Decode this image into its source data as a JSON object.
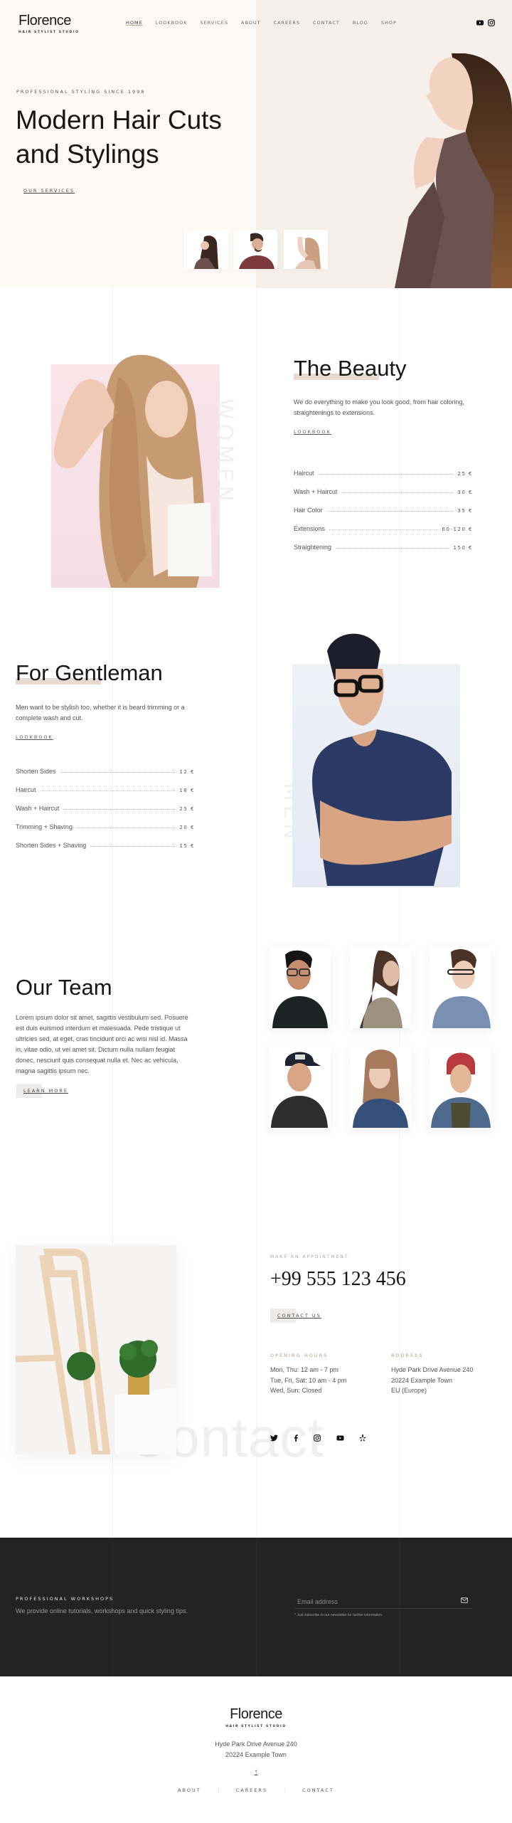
{
  "brand": {
    "name": "Florence",
    "tagline": "HAIR STYLIST STUDIO"
  },
  "nav": {
    "items": [
      {
        "label": "HOME",
        "active": true
      },
      {
        "label": "LOOKBOOK",
        "active": false
      },
      {
        "label": "SERVICES",
        "active": false
      },
      {
        "label": "ABOUT",
        "active": false
      },
      {
        "label": "CAREERS",
        "active": false
      },
      {
        "label": "CONTACT",
        "active": false
      },
      {
        "label": "BLOG",
        "active": false
      },
      {
        "label": "SHOP",
        "active": false
      }
    ],
    "social": [
      "youtube-icon",
      "instagram-icon"
    ]
  },
  "hero": {
    "kicker": "PROFESSIONAL STYLING SINCE 1998",
    "title_line1": "Modern Hair Cuts",
    "title_line2": "and Stylings",
    "button": "OUR SERVICES",
    "thumbnails": [
      "woman-profile",
      "man-beard",
      "woman-arm-raised"
    ]
  },
  "beauty": {
    "title": "The Beauty",
    "text": "We do everything to make you look good, from hair coloring, straightenings to extensions.",
    "link": "LOOKBOOK",
    "ghost_label": "WOMEN",
    "prices": [
      {
        "name": "Haircut",
        "price": "25 €"
      },
      {
        "name": "Wash + Haircut",
        "price": "30 €"
      },
      {
        "name": "Hair Color",
        "price": "35 €"
      },
      {
        "name": "Extensions",
        "price": "60-120 €"
      },
      {
        "name": "Straightening",
        "price": "150 €"
      }
    ]
  },
  "gentleman": {
    "title": "For Gentleman",
    "text": "Men want to be stylish too, whether it is beard trimming or a complete wash and cut.",
    "link": "LOOKBOOK",
    "ghost_label": "MEN",
    "prices": [
      {
        "name": "Shorten Sides",
        "price": "12 €"
      },
      {
        "name": "Haircut",
        "price": "18 €"
      },
      {
        "name": "Wash + Haircut",
        "price": "25 €"
      },
      {
        "name": "Trimming + Shaving",
        "price": "20 €"
      },
      {
        "name": "Shorten Sides + Shaving",
        "price": "15 €"
      }
    ]
  },
  "team": {
    "title": "Our Team",
    "text": "Lorem ipsum dolor sit amet, sagittis vestibulum sed. Posuere est duis euismod interdum et malesuada. Pede tristique ut ultricies sed, at eget, cras tincidunt orci ac wisi nisl id. Massa in, vitae odio, ut vel amet sit. Dictum nulla nullam feugiat donec, nesciunt quis consequat nulla et. Nec ac vehicula, magna sagittis ipsum nec.",
    "button": "LEARN MORE",
    "members": [
      {
        "photo": "man-glasses-black-tee"
      },
      {
        "photo": "woman-long-hair-looking-down"
      },
      {
        "photo": "man-glasses-denim-shirt"
      },
      {
        "photo": "man-cap-smiling"
      },
      {
        "photo": "woman-bangs-denim-jacket"
      },
      {
        "photo": "man-red-cap"
      }
    ]
  },
  "contact": {
    "kicker": "MAKE AN APPOINTMENT",
    "phone": "+99 555 123 456",
    "button": "CONTACT US",
    "watermark": "Contact",
    "hours_title": "OPENING HOURS",
    "hours": [
      "Mon, Thu: 12 am - 7 pm",
      "Tue, Fri, Sat: 10 am - 4 pm",
      "Wed, Sun: Closed"
    ],
    "address_title": "ADDRESS",
    "address": [
      "Hyde Park Drive Avenue 240",
      "20224 Example Town",
      "EU (Europe)"
    ],
    "social": [
      "twitter-icon",
      "facebook-icon",
      "instagram-icon",
      "youtube-icon",
      "yelp-icon"
    ]
  },
  "newsletter": {
    "title": "PROFESSIONAL WORKSHOPS",
    "text": "We provide online tutorials, workshops and quick styling tips.",
    "email_placeholder": "Email address",
    "note": "* Just subscribe to our newsletter for further information."
  },
  "footer": {
    "address": [
      "Hyde Park Drive Avenue 240",
      "20224 Example Town"
    ],
    "back_to_top": "↑",
    "links": [
      "ABOUT",
      "CAREERS",
      "CONTACT"
    ]
  },
  "colors": {
    "accent": "#e8d9d2",
    "label_accent": "#c09686",
    "hero_left_bg": "#fdf9f6",
    "hero_right_bg": "#f7efea",
    "dark_bg": "#232323"
  }
}
